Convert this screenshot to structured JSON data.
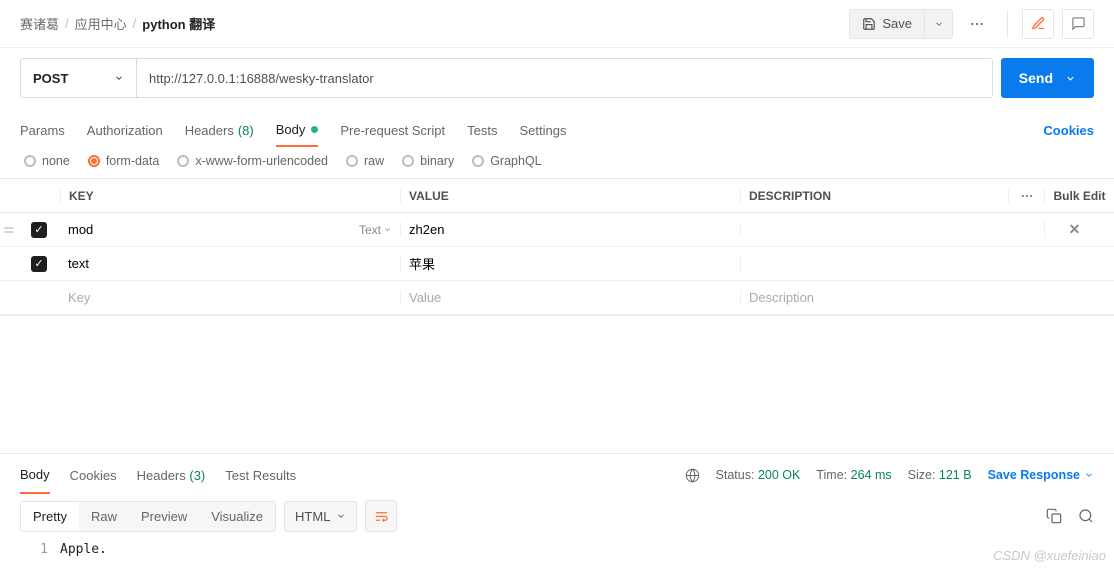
{
  "breadcrumbs": {
    "a": "赛诸葛",
    "b": "应用中心",
    "c": "python 翻译",
    "sep": "/"
  },
  "topbar": {
    "save": "Save"
  },
  "request": {
    "method": "POST",
    "url": "http://127.0.0.1:16888/wesky-translator",
    "send": "Send"
  },
  "tabs": {
    "params": "Params",
    "auth": "Authorization",
    "headers": "Headers",
    "headers_count": "(8)",
    "body": "Body",
    "prereq": "Pre-request Script",
    "tests": "Tests",
    "settings": "Settings",
    "cookies": "Cookies"
  },
  "bodyTypes": {
    "none": "none",
    "form": "form-data",
    "xwww": "x-www-form-urlencoded",
    "raw": "raw",
    "binary": "binary",
    "graphql": "GraphQL"
  },
  "table": {
    "head_key": "KEY",
    "head_val": "VALUE",
    "head_desc": "DESCRIPTION",
    "bulk": "Bulk Edit",
    "key_type": "Text",
    "ph_key": "Key",
    "ph_val": "Value",
    "ph_desc": "Description",
    "rows": [
      {
        "checked": true,
        "key": "mod",
        "val": "zh2en",
        "showType": true,
        "showDelete": true
      },
      {
        "checked": true,
        "key": "text",
        "val": "苹果",
        "showType": false,
        "showDelete": false
      }
    ]
  },
  "response": {
    "tabs": {
      "body": "Body",
      "cookies": "Cookies",
      "headers": "Headers",
      "headers_count": "(3)",
      "tests": "Test Results"
    },
    "status_lbl": "Status:",
    "status_val": "200 OK",
    "time_lbl": "Time:",
    "time_val": "264 ms",
    "size_lbl": "Size:",
    "size_val": "121 B",
    "save": "Save Response",
    "views": {
      "pretty": "Pretty",
      "raw": "Raw",
      "preview": "Preview",
      "visualize": "Visualize"
    },
    "format": "HTML",
    "line_no": "1",
    "content": "Apple."
  },
  "watermark": "CSDN @xuefeiniao"
}
